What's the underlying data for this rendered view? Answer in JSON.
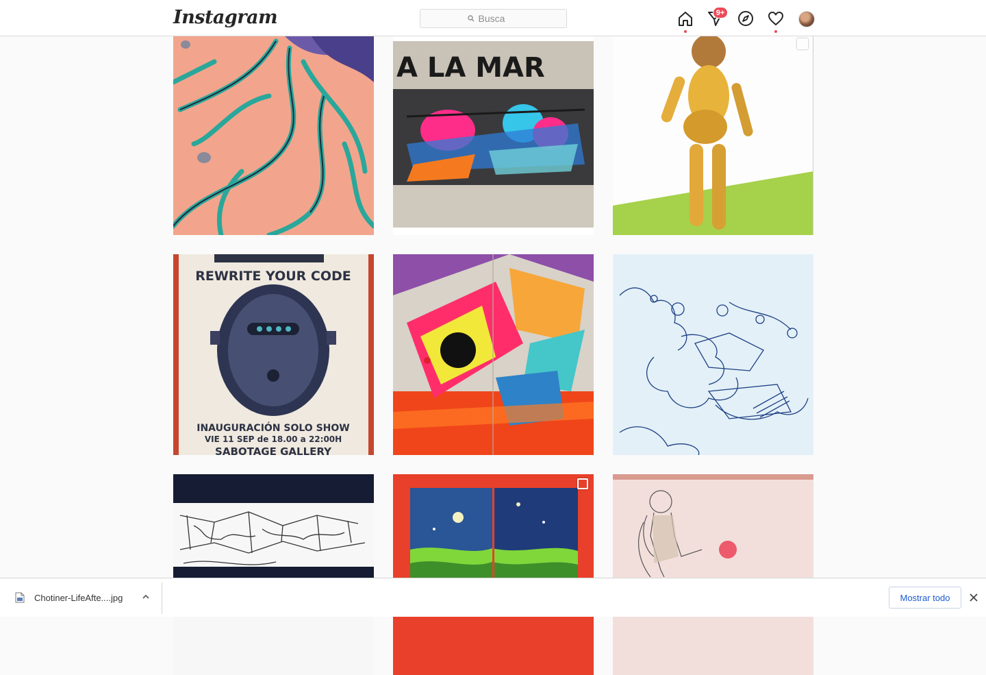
{
  "header": {
    "logo_text": "Instagram",
    "search": {
      "placeholder": "Busca"
    },
    "nav": [
      {
        "icon": "home-icon",
        "active_dot": true
      },
      {
        "icon": "direct-message-icon",
        "badge": "9+"
      },
      {
        "icon": "explore-compass-icon"
      },
      {
        "icon": "activity-heart-icon",
        "active_dot": true
      },
      {
        "icon": "profile-avatar"
      }
    ]
  },
  "grid": {
    "posts": [
      {
        "subject": "pink-sand-teal-roots-illustration",
        "multi": false
      },
      {
        "subject": "graffiti-wall",
        "painted_text": "A LA MAR",
        "multi": false
      },
      {
        "subject": "gold-robot-woman-illustration",
        "multi": true
      },
      {
        "subject": "exhibition-poster-robot-face",
        "poster_lines": [
          "REWRITE YOUR CODE",
          "INAUGURACIÓN SOLO SHOW",
          "VIE 11 SEP de 18.00 a 22:00H",
          "SABOTAGE GALLERY"
        ],
        "multi": false
      },
      {
        "subject": "colorful-robot-mural",
        "multi": false
      },
      {
        "subject": "blue-ink-cloud-sketch",
        "multi": false
      },
      {
        "subject": "pencil-graffiti-sketch",
        "multi": false
      },
      {
        "subject": "red-window-night-mural",
        "multi": true
      },
      {
        "subject": "astronaut-ball-mural",
        "multi": false
      }
    ]
  },
  "download_bar": {
    "filename": "Chotiner-LifeAfte....jpg",
    "show_all_label": "Mostrar todo"
  },
  "colors": {
    "accent_red": "#ed4956",
    "link_blue": "#1a5bd0",
    "border": "#dbdbdb",
    "background": "#fafafa"
  }
}
